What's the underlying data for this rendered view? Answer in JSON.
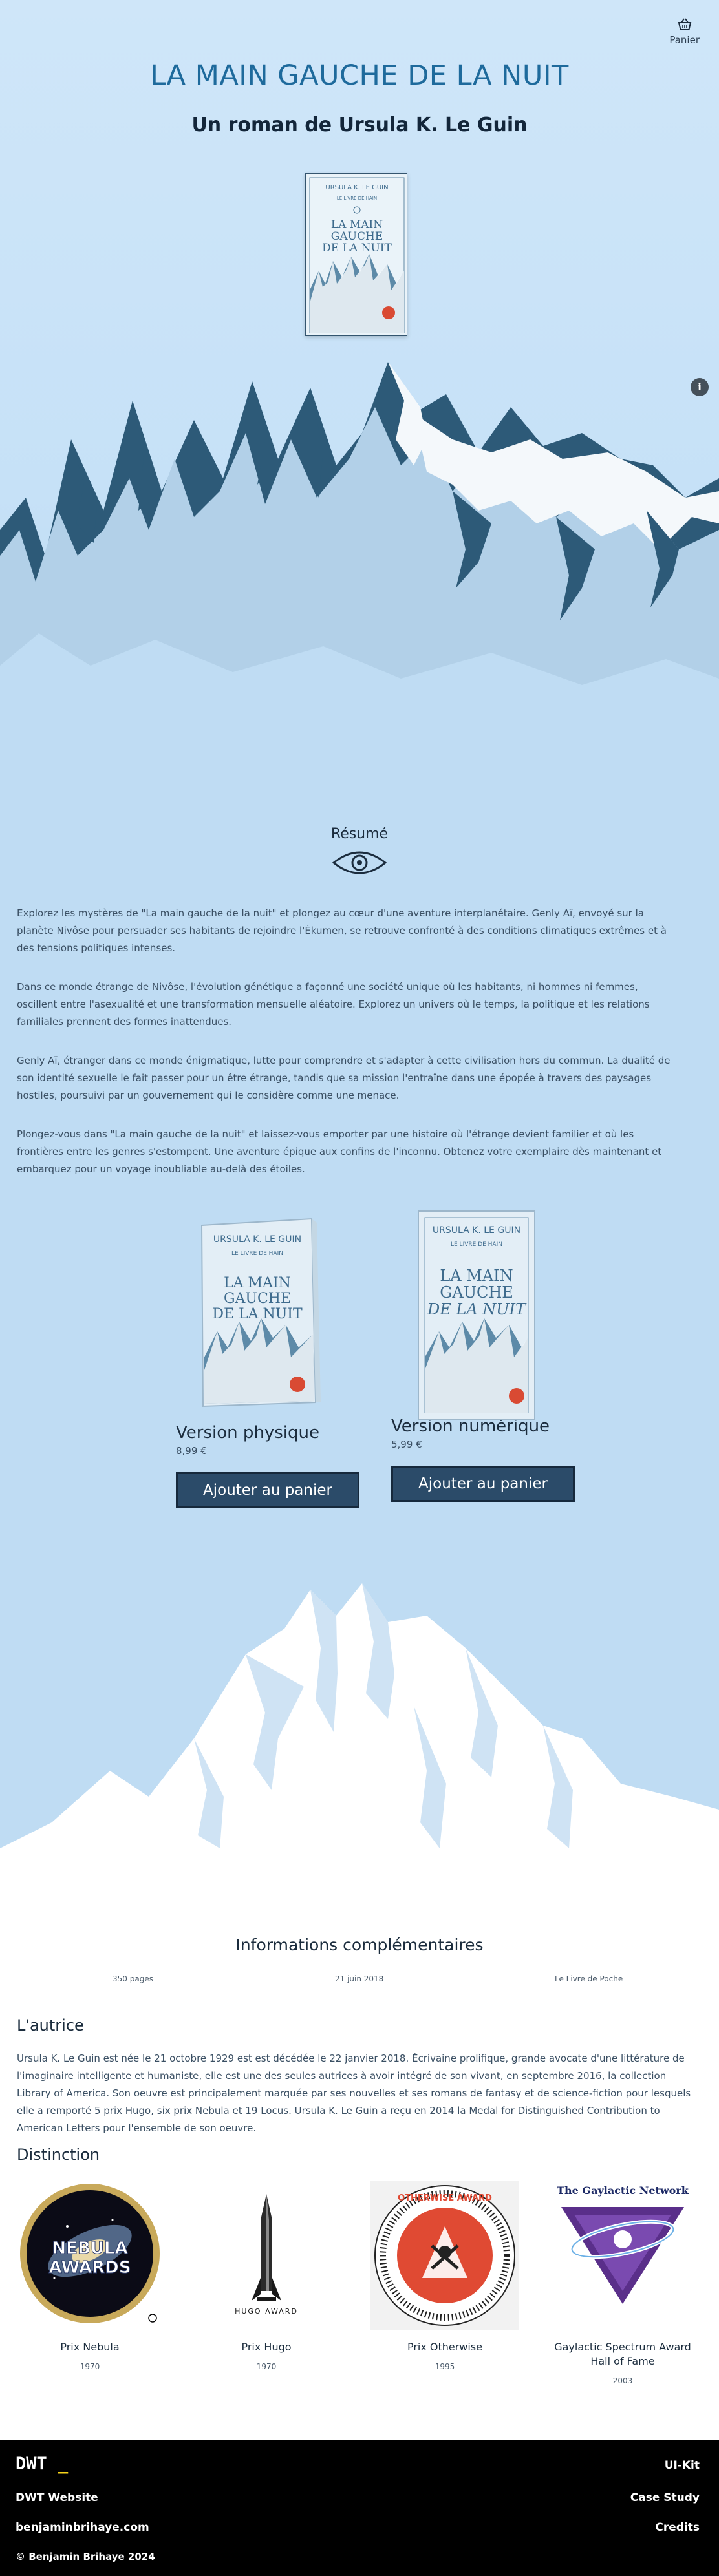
{
  "header": {
    "cart_label": "Panier"
  },
  "book": {
    "title": "LA MAIN GAUCHE DE LA NUIT",
    "subtitle": "Un roman de Ursula K. Le Guin",
    "cover_author": "URSULA K. LE GUIN",
    "cover_series": "LE LIVRE DE HAIN",
    "cover_title_1": "LA MAIN",
    "cover_title_2": "GAUCHE",
    "cover_title_3": "DE LA NUIT"
  },
  "resume": {
    "title": "Résumé",
    "paragraphs": [
      "Explorez les mystères de \"La main gauche de la nuit\" et plongez au cœur d'une aventure interplanétaire. Genly Aï, envoyé sur la planète Nivôse pour persuader ses habitants de rejoindre l'Ékumen, se retrouve confronté à des conditions climatiques extrêmes et à des tensions politiques intenses.",
      "Dans ce monde étrange de Nivôse, l'évolution génétique a façonné une société unique où les habitants, ni hommes ni femmes, oscillent entre l'asexualité et une transformation mensuelle aléatoire. Explorez un univers où le temps, la politique et les relations familiales prennent des formes inattendues.",
      "Genly Aï, étranger dans ce monde énigmatique, lutte pour comprendre et s'adapter à cette civilisation hors du commun. La dualité de son identité sexuelle le fait passer pour un être étrange, tandis que sa mission l'entraîne dans une épopée à travers des paysages hostiles, poursuivi par un gouvernement qui le considère comme une menace.",
      "Plongez-vous dans \"La main gauche de la nuit\" et laissez-vous emporter par une histoire où l'étrange devient familier et où les frontières entre les genres s'estompent. Une aventure épique aux confins de l'inconnu. Obtenez votre exemplaire dès maintenant et embarquez pour un voyage inoubliable au-delà des étoiles."
    ]
  },
  "products": [
    {
      "name": "Version physique",
      "price": "8,99 €",
      "button": "Ajouter au panier"
    },
    {
      "name": "Version numérique",
      "price": "5,99 €",
      "button": "Ajouter au panier"
    }
  ],
  "info": {
    "title": "Informations complémentaires",
    "pages": "350 pages",
    "date": "21 juin 2018",
    "publisher": "Le Livre de Poche"
  },
  "author": {
    "title": "L'autrice",
    "text": "Ursula K. Le Guin est née le 21 octobre 1929 est est décédée le 22 janvier 2018. Écrivaine prolifique, grande avocate d'une littérature de l'imaginaire intelligente et humaniste, elle est une des seules autrices à avoir intégré de son vivant, en septembre 2016, la collection Library of America. Son oeuvre est principalement marquée par ses nouvelles et ses romans de fantasy et de science-fiction pour lesquels elle a remporté 5 prix Hugo, six prix Nebula et 19 Locus. Ursula K. Le Guin a reçu en 2014 la Medal for Distinguished Contribution to American Letters pour l'ensemble de son oeuvre."
  },
  "distinction": {
    "title": "Distinction",
    "awards": [
      {
        "name": "Prix Nebula",
        "year": "1970",
        "logo_text_1": "NEBULA",
        "logo_text_2": "AWARDS"
      },
      {
        "name": "Prix Hugo",
        "year": "1970",
        "logo_text_1": "HUGO AWARD"
      },
      {
        "name": "Prix Otherwise",
        "year": "1995",
        "logo_text_1": "OTHERWISE AWARD"
      },
      {
        "name": "Gaylactic Spectrum Award Hall of Fame",
        "year": "2003",
        "logo_text_1": "The Gaylactic Network"
      }
    ]
  },
  "footer": {
    "logo": "DWT",
    "logo_cursor": "_",
    "links_left": [
      "DWT Website",
      "benjaminbrihaye.com"
    ],
    "copyright": "© Benjamin Brihaye 2024",
    "links_right": [
      "UI-Kit",
      "Case Study",
      "Credits"
    ]
  },
  "colors": {
    "sky": "#c6e1f7",
    "mountain_dark": "#2d5a78",
    "mountain_light": "#b2d0e8",
    "title_blue": "#1e6a9c",
    "button": "#2b4b69",
    "footer": "#000000",
    "logo_cursor": "#f5d21a"
  }
}
